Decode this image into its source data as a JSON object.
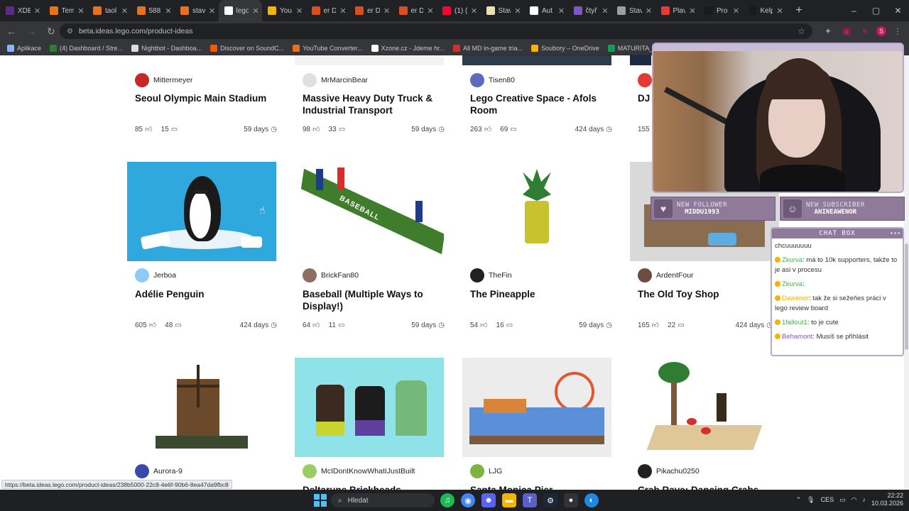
{
  "browser": {
    "tabs": [
      {
        "label": "XDE",
        "color": "#5b2c83"
      },
      {
        "label": "Tem",
        "color": "#e8711c"
      },
      {
        "label": "taol",
        "color": "#e8711c"
      },
      {
        "label": "588",
        "color": "#e8711c"
      },
      {
        "label": "stav",
        "color": "#e8711c"
      },
      {
        "label": "lego",
        "color": "#ffffff",
        "active": true
      },
      {
        "label": "You",
        "color": "#f4b400"
      },
      {
        "label": "er D",
        "color": "#d9501e"
      },
      {
        "label": "er D",
        "color": "#d9501e"
      },
      {
        "label": "er D",
        "color": "#d9501e"
      },
      {
        "label": "(1) (",
        "color": "#ff0033"
      },
      {
        "label": "Stav",
        "color": "#e9e1b0"
      },
      {
        "label": "Aut",
        "color": "#ffffff"
      },
      {
        "label": "čtyř",
        "color": "#7e57c2"
      },
      {
        "label": "Stav",
        "color": "#9aa0a6"
      },
      {
        "label": "Plav",
        "color": "#e53935"
      },
      {
        "label": "Pro",
        "color": "#1b1b1b"
      },
      {
        "label": "Kelp",
        "color": "#1b1b1b"
      }
    ],
    "new_tab": "+",
    "window_controls": [
      "–",
      "▢",
      "✕"
    ],
    "url": "beta.ideas.lego.com/product-ideas",
    "bookmarks": [
      {
        "label": "Aplikace",
        "color": "#8ab4f8"
      },
      {
        "label": "(4) Dashboard / Stre...",
        "color": "#2e7d32"
      },
      {
        "label": "Nightbot - Dashboa...",
        "color": "#dddddd"
      },
      {
        "label": "Discover on SoundC...",
        "color": "#ff5500"
      },
      {
        "label": "YouTube Converter...",
        "color": "#e8711c"
      },
      {
        "label": "Xzone.cz - Jdeme hr...",
        "color": "#ffffff"
      },
      {
        "label": "All MD in-game tria...",
        "color": "#d32f2f"
      },
      {
        "label": "Soubory – OneDrive",
        "color": "#f4b400"
      },
      {
        "label": "MATURITA_OKRUH...",
        "color": "#0f9d58"
      }
    ],
    "status_url": "https://beta.ideas.lego.com/product-ideas/238b5000-22c8-4e6f-90b6-8ea47da9fbc8"
  },
  "page": {
    "row1": [
      {
        "author": "Mittermeyer",
        "title": "Seoul Olympic Main Stadium",
        "likes": "85",
        "comments": "15",
        "days": "59 days",
        "avatar": "#c62828"
      },
      {
        "author": "MrMarcinBear",
        "title": "Massive Heavy Duty Truck & Industrial Transport",
        "likes": "98",
        "comments": "33",
        "days": "59 days",
        "avatar": "#e0e0e0"
      },
      {
        "author": "Tisen80",
        "title": "Lego Creative Space - Afols Room",
        "likes": "263",
        "comments": "69",
        "days": "424 days",
        "avatar": "#5c6bc0"
      },
      {
        "author": "",
        "title": "DJ",
        "likes": "155",
        "comments": "",
        "days": "",
        "avatar": "#e53935"
      }
    ],
    "row2": [
      {
        "author": "Jerboa",
        "title": "Adélie Penguin",
        "likes": "605",
        "comments": "48",
        "days": "424 days",
        "avatar": "#90caf9"
      },
      {
        "author": "BrickFan80",
        "title": "Baseball (Multiple Ways to Display!)",
        "likes": "64",
        "comments": "11",
        "days": "59 days",
        "avatar": "#8d6e63"
      },
      {
        "author": "TheFin",
        "title": "The Pineapple",
        "likes": "54",
        "comments": "16",
        "days": "59 days",
        "avatar": "#212121"
      },
      {
        "author": "ArdentFour",
        "title": "The Old Toy Shop",
        "likes": "165",
        "comments": "22",
        "days": "424 days",
        "avatar": "#6d4c41"
      }
    ],
    "row3": [
      {
        "author": "Aurora-9",
        "title": "",
        "avatar": "#3949ab"
      },
      {
        "author": "McIDontKnowWhatIJustBuilt",
        "title": "Deltarune Brickheads",
        "avatar": "#9ccc65"
      },
      {
        "author": "LJG",
        "title": "Santa Monica Pier",
        "avatar": "#7cb342"
      },
      {
        "author": "Pikachu0250",
        "title": "Crab Rave: Dancing Crabs",
        "avatar": "#212121"
      }
    ],
    "thumb_labels": {
      "baseball": "BASEBALL"
    }
  },
  "stream": {
    "follower_label": "NEW FOLLOWER",
    "follower_value": "MIDDU1993",
    "subscriber_label": "NEW SUBSCRIBER",
    "subscriber_value": "ANINEAWENOR",
    "chat_title": "CHAT BOX",
    "chat": [
      {
        "user": "",
        "text": "chcuuuuuuu",
        "color": "#333333"
      },
      {
        "user": "Zkurva",
        "text": ": má to 10k supporters, takže to je asi v procesu",
        "color": "#4caf50"
      },
      {
        "user": "Zkurva",
        "text": ":",
        "color": "#4caf50"
      },
      {
        "user": "Dawenor",
        "text": ": tak že si sežeňes práci v lego review board",
        "color": "#f4b400"
      },
      {
        "user": "1fallout1",
        "text": ": to je cute",
        "color": "#4caf50"
      },
      {
        "user": "Behamont",
        "text": ": Musíš se přihlásit",
        "color": "#7e57c2"
      }
    ]
  },
  "taskbar": {
    "search_placeholder": "Hledat",
    "lang": "CES",
    "time": "22:22",
    "date": "10.03.2026"
  }
}
